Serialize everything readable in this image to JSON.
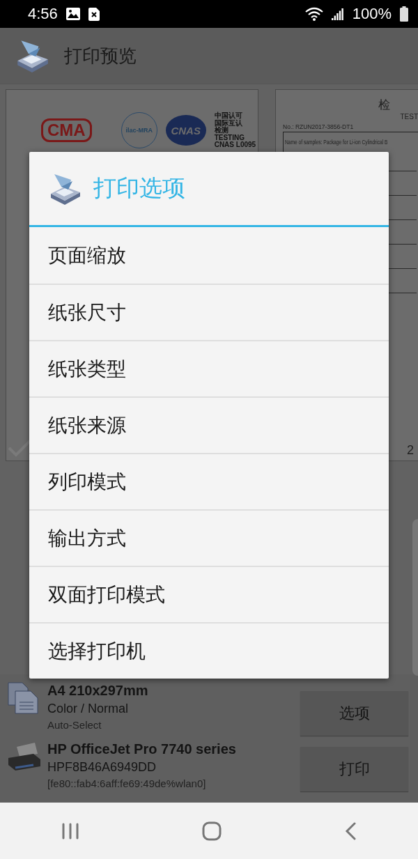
{
  "status_bar": {
    "time": "4:56",
    "battery": "100%"
  },
  "app_bar": {
    "title": "打印预览"
  },
  "preview_pages": [
    {
      "logos": [
        "CMA",
        "ilac-MRA",
        "CNAS"
      ],
      "accreditation_lines": [
        "中国认可",
        "国际互认",
        "检测",
        "TESTING",
        "CNAS L0095"
      ]
    },
    {
      "heading": "检",
      "subheading": "TEST",
      "report_number": "No.: RZUN2017-3856-DT1",
      "sample_line": "Name of samples: Package for Li-ion Cylindrical B",
      "page_number": "2"
    }
  ],
  "dialog": {
    "title": "打印选项",
    "items": [
      "页面缩放",
      "纸张尺寸",
      "纸张类型",
      "纸张来源",
      "列印模式",
      "输出方式",
      "双面打印模式",
      "选择打印机"
    ]
  },
  "paper": {
    "size": "A4 210x297mm",
    "mode": "Color / Normal",
    "source": "Auto-Select"
  },
  "printer": {
    "name": "HP OfficeJet Pro 7740 series",
    "id": "HPF8B46A6949DD",
    "address": "[fe80::fab4:6aff:fe69:49de%wlan0]"
  },
  "buttons": [
    "选项",
    "打印"
  ]
}
